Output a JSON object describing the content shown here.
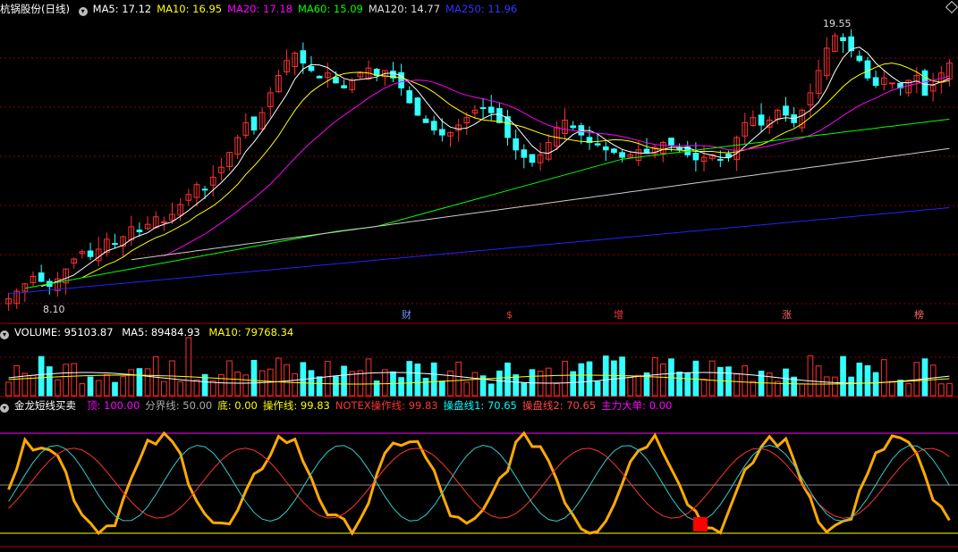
{
  "panel_main": {
    "stock_name": "杭锅股份",
    "period": "(日线)",
    "indicators": [
      {
        "label": "MA5: 17.12",
        "color": "#ffffff"
      },
      {
        "label": "MA10: 16.95",
        "color": "#ffff00"
      },
      {
        "label": "MA20: 17.18",
        "color": "#ff00ff"
      },
      {
        "label": "MA60: 15.09",
        "color": "#00ff00"
      },
      {
        "label": "MA120: 14.77",
        "color": "#dddddd"
      },
      {
        "label": "MA250: 11.96",
        "color": "#3333ff"
      }
    ],
    "high_label": "19.55",
    "low_label": "8.10",
    "events": [
      {
        "label": "财",
        "color": "#6699ff"
      },
      {
        "label": "$",
        "color": "#ff3333"
      },
      {
        "label": "增",
        "color": "#ff3333"
      },
      {
        "label": "涨",
        "color": "#ff6666"
      },
      {
        "label": "榜",
        "color": "#ff6666"
      }
    ]
  },
  "panel_volume": {
    "title": "VOLUME: 95103.87",
    "ma5": "MA5: 89484.93",
    "ma10": "MA10: 79768.34"
  },
  "panel_indicator": {
    "title": "金龙短线买卖",
    "items": [
      {
        "label": "顶: 100.00",
        "color": "#ff00ff"
      },
      {
        "label": "分界线: 50.00",
        "color": "#aaaaaa"
      },
      {
        "label": "底: 0.00",
        "color": "#ffff00"
      },
      {
        "label": "操作线: 99.83",
        "color": "#ffff00"
      },
      {
        "label": "NOTEX操作线: 99.83",
        "color": "#ff3333"
      },
      {
        "label": "操盘线1: 70.65",
        "color": "#00ffff"
      },
      {
        "label": "操盘线2: 70.65",
        "color": "#ff4444"
      },
      {
        "label": "主力大单: 0.00",
        "color": "#ff00ff"
      }
    ]
  },
  "colors": {
    "up": "#ff3030",
    "down": "#33ffff",
    "grid": "#8b0000",
    "ma5": "#ffffff",
    "ma10": "#ffff00",
    "ma20": "#ff00ff",
    "ma60": "#00ff00",
    "ma120": "#cccccc",
    "ma250": "#2222ff",
    "op_line": "#ffaa00"
  },
  "chart_data": {
    "type": "candlestick",
    "ylim": [
      8.1,
      19.55
    ],
    "close_series": [
      8.3,
      8.6,
      8.9,
      9.2,
      9.0,
      8.8,
      9.1,
      9.5,
      9.9,
      10.2,
      10.0,
      10.3,
      10.7,
      10.5,
      10.8,
      11.2,
      11.0,
      11.3,
      11.6,
      11.4,
      11.7,
      12.1,
      12.5,
      12.9,
      12.7,
      13.2,
      13.6,
      14.2,
      14.8,
      15.4,
      15.1,
      15.8,
      16.6,
      17.3,
      17.9,
      18.2,
      17.8,
      17.5,
      17.2,
      17.4,
      17.0,
      16.8,
      17.1,
      17.4,
      17.6,
      17.3,
      17.5,
      17.2,
      16.8,
      16.2,
      15.7,
      15.4,
      15.1,
      14.9,
      15.0,
      15.3,
      15.6,
      15.9,
      16.0,
      15.8,
      15.4,
      14.8,
      14.3,
      14.0,
      13.8,
      14.1,
      14.6,
      15.2,
      15.5,
      15.2,
      14.9,
      14.6,
      14.5,
      14.3,
      14.2,
      14.0,
      14.1,
      14.3,
      14.2,
      14.4,
      14.6,
      14.5,
      14.3,
      14.1,
      13.9,
      14.0,
      14.1,
      13.9,
      14.0,
      14.8,
      15.4,
      15.6,
      15.3,
      15.5,
      15.9,
      15.7,
      15.4,
      15.9,
      16.6,
      17.5,
      18.4,
      18.9,
      18.7,
      18.3,
      17.9,
      17.2,
      16.9,
      17.2,
      17.0,
      16.8,
      17.1,
      17.3,
      16.5,
      16.9,
      17.4,
      17.8
    ]
  }
}
